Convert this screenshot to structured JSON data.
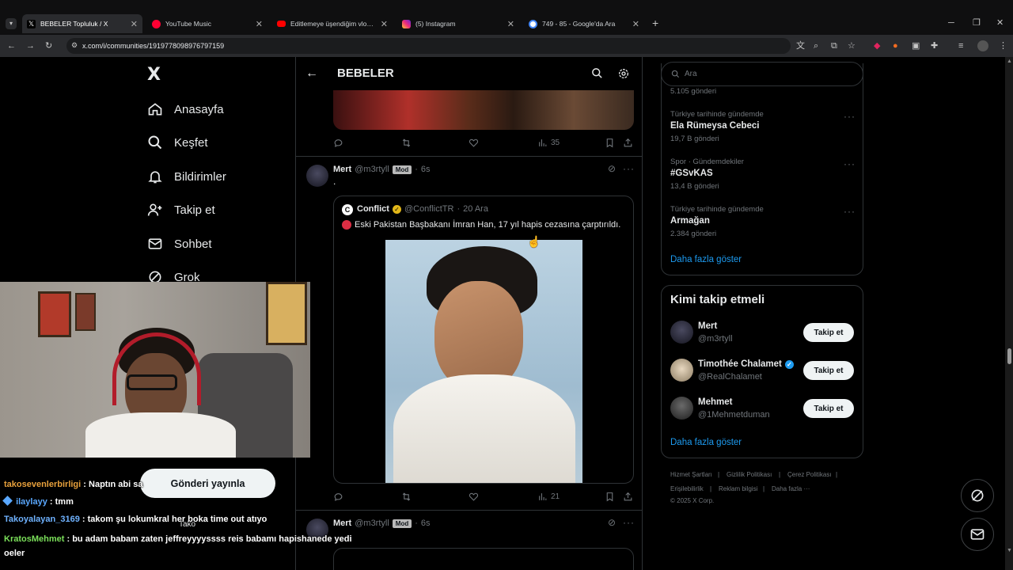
{
  "browser": {
    "tabs": [
      {
        "title": "BEBELER Topluluk / X",
        "favicon": "x-logo"
      },
      {
        "title": "YouTube Music",
        "favicon": "youtube-music"
      },
      {
        "title": "Editlemeye üşendiğim vlog - Yo",
        "favicon": "youtube"
      },
      {
        "title": "(5) Instagram",
        "favicon": "instagram"
      },
      {
        "title": "749 - 85 - Google'da Ara",
        "favicon": "google"
      }
    ],
    "new_tab": "+",
    "url": "x.com/i/communities/1919778098976797159"
  },
  "nav": {
    "logo": "X",
    "items": [
      {
        "label": "Anasayfa",
        "icon": "home-icon"
      },
      {
        "label": "Keşfet",
        "icon": "search-icon"
      },
      {
        "label": "Bildirimler",
        "icon": "bell-icon"
      },
      {
        "label": "Takip et",
        "icon": "person-add-icon"
      },
      {
        "label": "Sohbet",
        "icon": "mail-icon"
      },
      {
        "label": "Grok",
        "icon": "grok-icon"
      }
    ],
    "post_button": "Gönderi yayınla"
  },
  "header": {
    "title": "BEBELER"
  },
  "top_post": {
    "views": "35"
  },
  "post": {
    "author": "Mert",
    "handle": "@m3rtyll",
    "badge": "Mod",
    "sep": "·",
    "time": "6s",
    "text": ".",
    "quote": {
      "author": "Conflict",
      "handle": "@ConflictTR",
      "sep": "·",
      "date": "20 Ara",
      "text": "Eski Pakistan Başbakanı İmran Han, 17 yıl hapis cezasına çarptırıldı."
    },
    "views": "21"
  },
  "next_post": {
    "author": "Mert",
    "handle": "@m3rtyll",
    "badge": "Mod",
    "sep": "·",
    "time": "6s"
  },
  "search": {
    "placeholder": "Ara"
  },
  "trends": {
    "top_count": "5.105 gönderi",
    "items": [
      {
        "category": "Türkiye tarihinde gündemde",
        "name": "Ela Rümeysa Cebeci",
        "count": "19,7 B gönderi"
      },
      {
        "category": "Spor · Gündemdekiler",
        "name": "#GSvKAS",
        "count": "13,4 B gönderi"
      },
      {
        "category": "Türkiye tarihinde gündemde",
        "name": "Armağan",
        "count": "2.384 gönderi"
      }
    ],
    "more": "Daha fazla göster"
  },
  "who_to_follow": {
    "title": "Kimi takip etmeli",
    "users": [
      {
        "name": "Mert",
        "handle": "@m3rtyll",
        "verified": false,
        "button": "Takip et"
      },
      {
        "name": "Timothée Chalamet",
        "handle": "@RealChalamet",
        "verified": true,
        "button": "Takip et"
      },
      {
        "name": "Mehmet",
        "handle": "@1Mehmetduman",
        "verified": false,
        "button": "Takip et"
      }
    ],
    "more": "Daha fazla göster"
  },
  "footer": {
    "links": [
      "Hizmet Şartları",
      "Gizlilik Politikası",
      "Çerez Politikası",
      "Erişilebilirlik",
      "Reklam bilgisi",
      "Daha fazla ···"
    ],
    "seps": [
      "|",
      "|",
      "|",
      "|",
      "|"
    ],
    "copyright": "© 2025 X Corp."
  },
  "chat": [
    {
      "user": "takosevenlerbirligi",
      "sep": ":",
      "text": "Naptın abi sa",
      "color": "#e8a13c"
    },
    {
      "user": "ilaylayy",
      "sep": ":",
      "text": "tmm",
      "color": "#5aa8ff"
    },
    {
      "user": "Takoyalayan_3169",
      "sep": ":",
      "text": "takom şu lokumkral her boka time out atıyo",
      "color": "#6fb2ff"
    },
    {
      "user": "KratosMehmet",
      "sep": ":",
      "text": "bu adam babam zaten jeffreyyyyssss reis babamı hapishanede yedi oeler",
      "color": "#7be05a"
    }
  ],
  "overlay_fragment": "Tako",
  "colors": {
    "accent": "#1d9bf0",
    "background": "#000000",
    "border": "#2f3336",
    "muted": "#71767b"
  }
}
